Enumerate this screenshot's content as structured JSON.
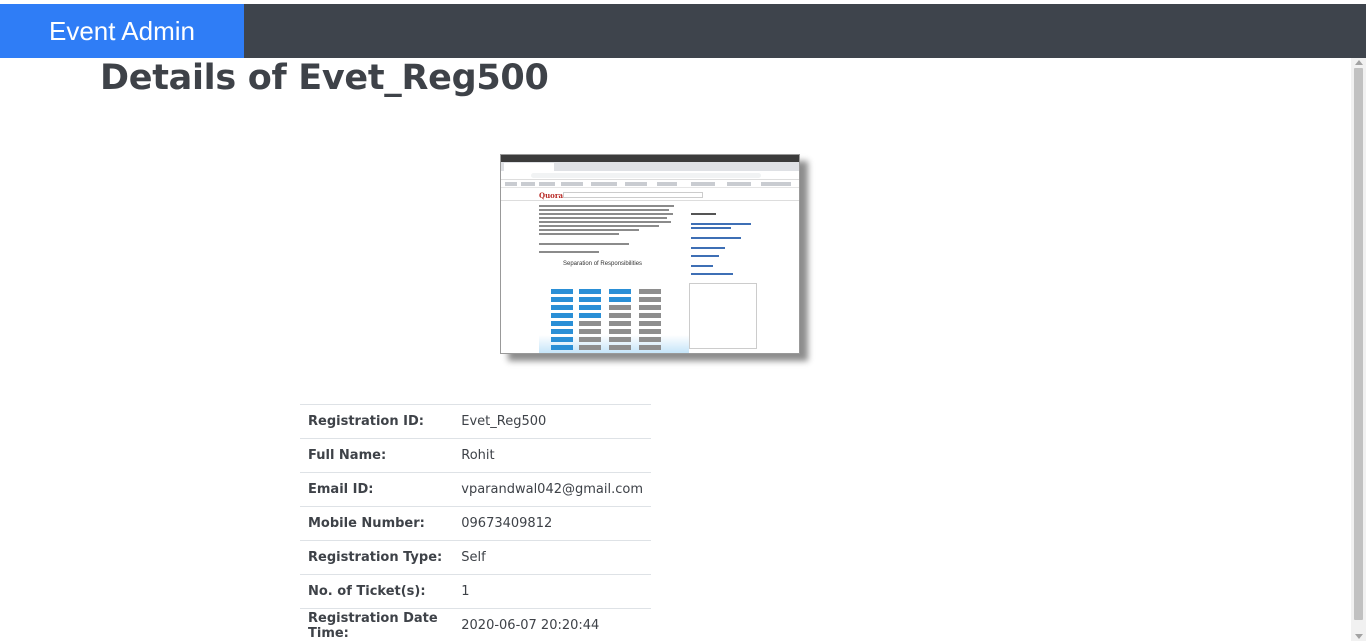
{
  "app": {
    "brand": "Event Admin",
    "brand_color": "#2f7df6",
    "navbar_color": "#3e444c"
  },
  "page": {
    "title": "Details of Evet_Reg500"
  },
  "image": {
    "alt": "uploaded screenshot",
    "logo_text": "Quora",
    "heading": "Separation of Responsibilities"
  },
  "details": {
    "rows": [
      {
        "label": "Registration ID:",
        "value": "Evet_Reg500"
      },
      {
        "label": "Full Name:",
        "value": "Rohit"
      },
      {
        "label": "Email ID:",
        "value": "vparandwal042@gmail.com"
      },
      {
        "label": "Mobile Number:",
        "value": "09673409812"
      },
      {
        "label": "Registration Type:",
        "value": "Self"
      },
      {
        "label": "No. of Ticket(s):",
        "value": "1"
      },
      {
        "label": "Registration Date Time:",
        "value": "2020-06-07 20:20:44"
      }
    ]
  }
}
